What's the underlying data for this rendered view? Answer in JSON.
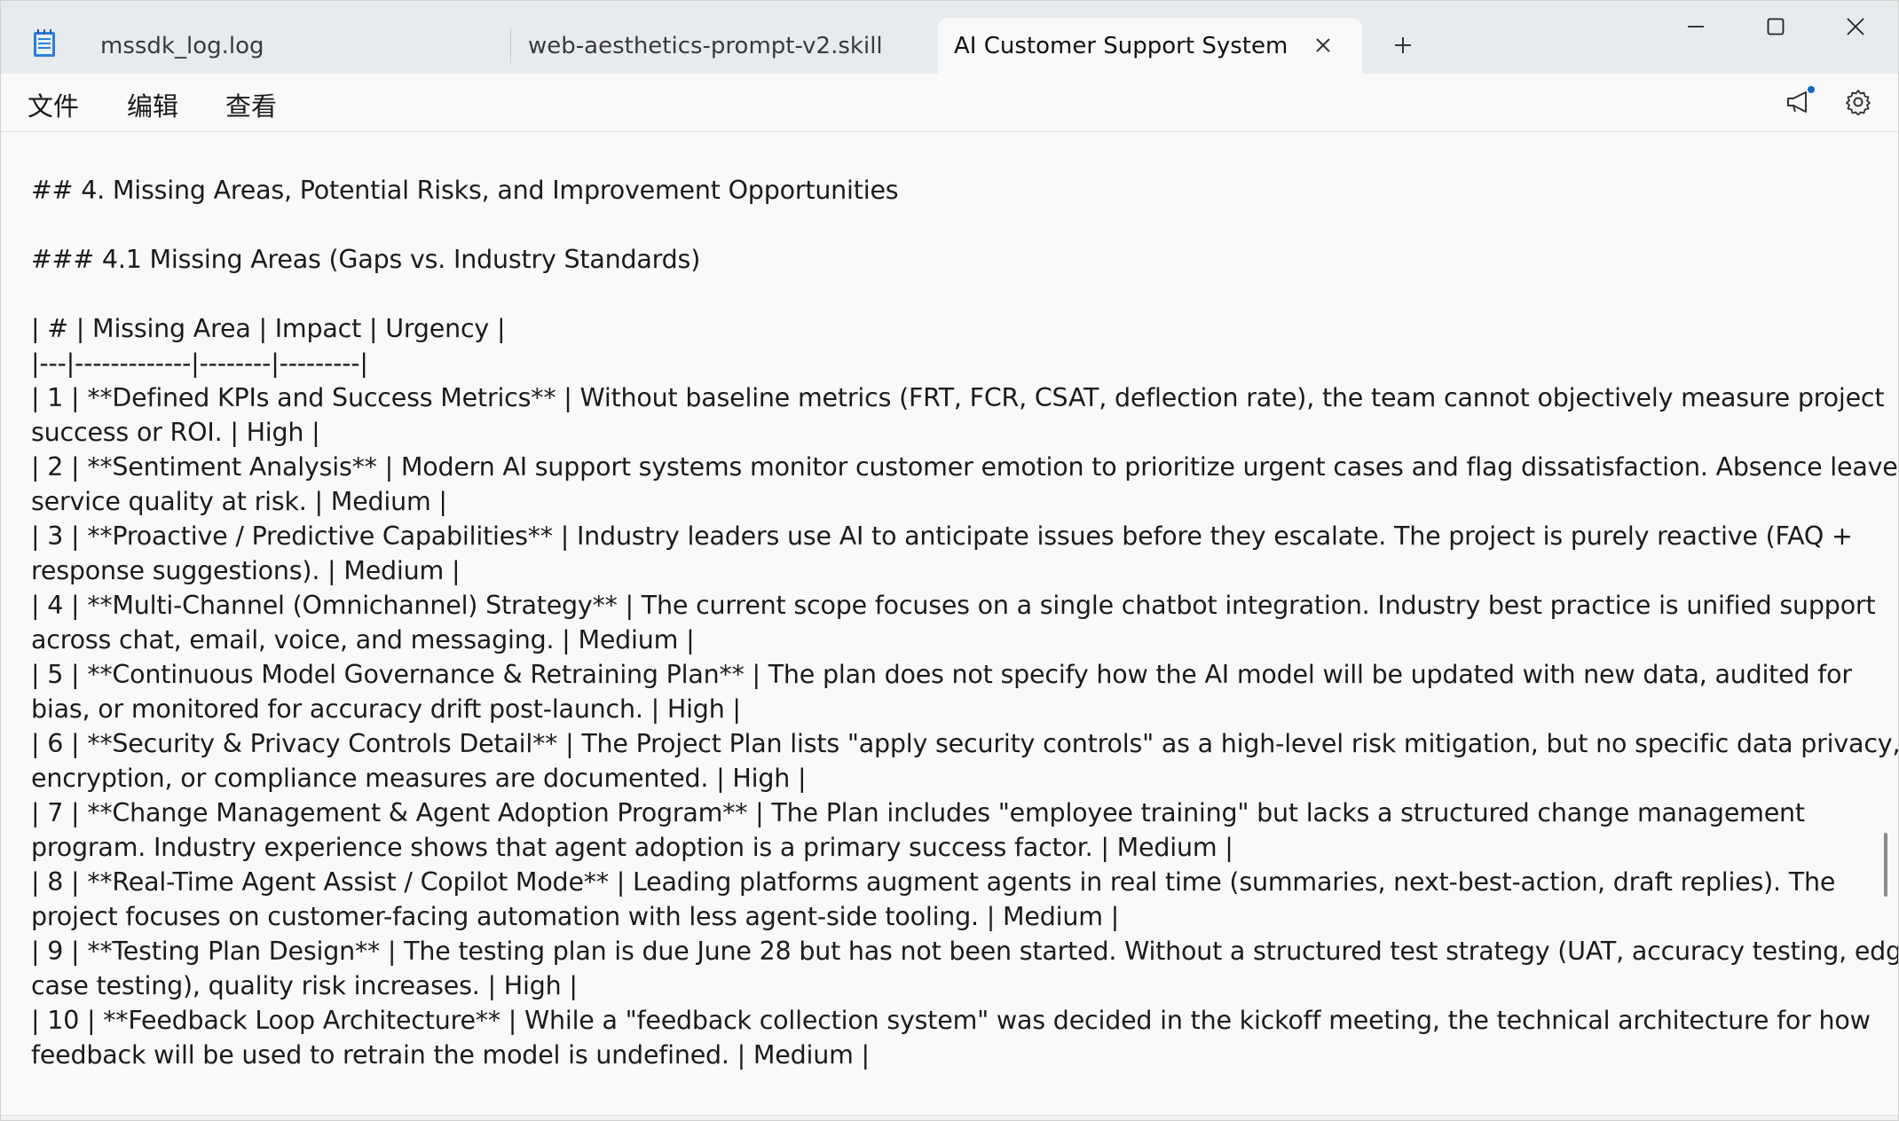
{
  "tabs": [
    {
      "label": "mssdk_log.log",
      "active": false
    },
    {
      "label": "web-aesthetics-prompt-v2.skill",
      "active": false
    },
    {
      "label": "AI Customer Support System Upgr",
      "active": true
    }
  ],
  "icons": {
    "app": "notepad-icon",
    "tab_close": "close-icon",
    "new_tab": "plus-icon",
    "minimize": "minimize-icon",
    "maximize": "maximize-icon",
    "close": "close-icon",
    "announce": "megaphone-icon",
    "settings": "gear-icon"
  },
  "menu": {
    "file": "文件",
    "edit": "编辑",
    "view": "查看"
  },
  "colors": {
    "titlebar": "#e8ebee",
    "editor_bg": "#f9f9f9",
    "accent": "#0f6cbd"
  },
  "document": {
    "lines": [
      "## 4. Missing Areas, Potential Risks, and Improvement Opportunities",
      "",
      "### 4.1 Missing Areas (Gaps vs. Industry Standards)",
      "",
      "| # | Missing Area | Impact | Urgency |",
      "|---|-------------|--------|---------|",
      "| 1 | **Defined KPIs and Success Metrics** | Without baseline metrics (FRT, FCR, CSAT, deflection rate), the team cannot objectively measure project",
      "success or ROI. | High |",
      "| 2 | **Sentiment Analysis** | Modern AI support systems monitor customer emotion to prioritize urgent cases and flag dissatisfaction. Absence leaves",
      "service quality at risk. | Medium |",
      "| 3 | **Proactive / Predictive Capabilities** | Industry leaders use AI to anticipate issues before they escalate. The project is purely reactive (FAQ +",
      "response suggestions). | Medium |",
      "| 4 | **Multi-Channel (Omnichannel) Strategy** | The current scope focuses on a single chatbot integration. Industry best practice is unified support",
      "across chat, email, voice, and messaging. | Medium |",
      "| 5 | **Continuous Model Governance & Retraining Plan** | The plan does not specify how the AI model will be updated with new data, audited for",
      "bias, or monitored for accuracy drift post-launch. | High |",
      "| 6 | **Security & Privacy Controls Detail** | The Project Plan lists \"apply security controls\" as a high-level risk mitigation, but no specific data privacy,",
      "encryption, or compliance measures are documented. | High |",
      "| 7 | **Change Management & Agent Adoption Program** | The Plan includes \"employee training\" but lacks a structured change management",
      "program. Industry experience shows that agent adoption is a primary success factor. | Medium |",
      "| 8 | **Real-Time Agent Assist / Copilot Mode** | Leading platforms augment agents in real time (summaries, next-best-action, draft replies). The",
      "project focuses on customer-facing automation with less agent-side tooling. | Medium |",
      "| 9 | **Testing Plan Design** | The testing plan is due June 28 but has not been started. Without a structured test strategy (UAT, accuracy testing, edge-",
      "case testing), quality risk increases. | High |",
      "| 10 | **Feedback Loop Architecture** | While a \"feedback collection system\" was decided in the kickoff meeting, the technical architecture for how",
      "feedback will be used to retrain the model is undefined. | Medium |"
    ]
  }
}
